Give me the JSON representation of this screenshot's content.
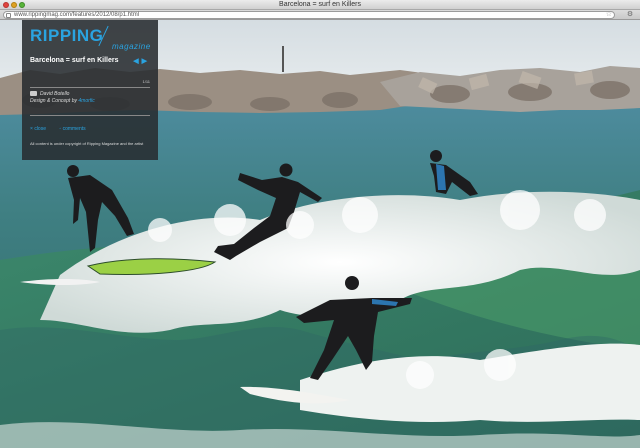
{
  "browser": {
    "window_title": "Barcelona = surf en Killers",
    "url": "www.rippingmag.com/features/2012/08/p1.html"
  },
  "panel": {
    "logo": "RIPPING",
    "logo_sub": "magazine",
    "article_title": "Barcelona = surf en Killers",
    "prev_arrow": "◀",
    "next_arrow": "▶",
    "counter": "1/11",
    "photographer": "David Botello",
    "concept_prefix": "Design & Concept by",
    "concept_link": "4morfic",
    "close_label": "close",
    "comments_label": "comments",
    "copyright": "All content is under copyright of Ripping Magazine and the artist"
  },
  "colors": {
    "accent": "#2aa3e0",
    "sky": "#dfe6ea",
    "sea": "#3e7f79",
    "foam": "#ecf0ee"
  }
}
